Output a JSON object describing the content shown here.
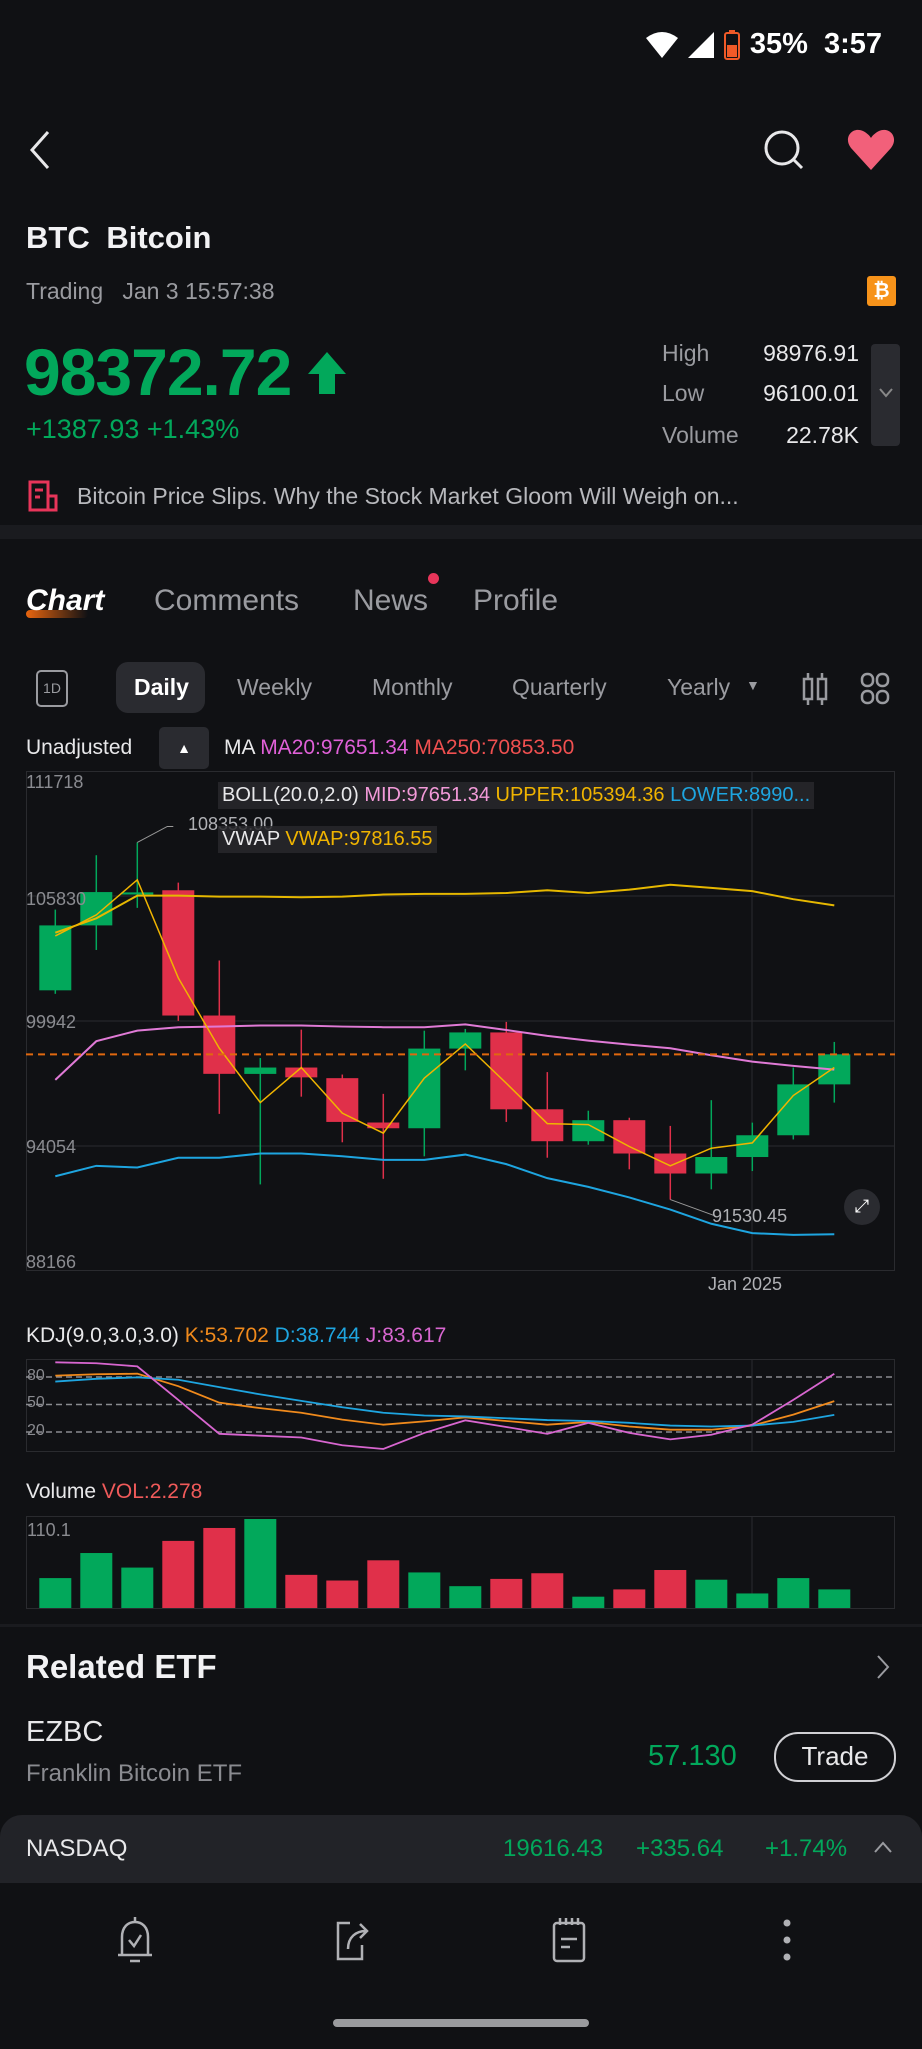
{
  "status_bar": {
    "battery": "35%",
    "time": "3:57"
  },
  "header": {
    "symbol": "BTC",
    "name": "Bitcoin",
    "state": "Trading",
    "timestamp": "Jan 3 15:57:38",
    "badge_icon": "bitcoin-icon"
  },
  "quote": {
    "price": "98372.72",
    "change": "+1387.93",
    "change_pct": "+1.43%",
    "direction": "up",
    "stats": [
      {
        "label": "High",
        "value": "98976.91"
      },
      {
        "label": "Low",
        "value": "96100.01"
      },
      {
        "label": "Volume",
        "value": "22.78K"
      }
    ]
  },
  "news_headline": "Bitcoin Price Slips. Why the Stock Market Gloom Will Weigh on...",
  "tabs": [
    {
      "label": "Chart",
      "active": true
    },
    {
      "label": "Comments"
    },
    {
      "label": "News",
      "dot": true
    },
    {
      "label": "Profile"
    }
  ],
  "periods": {
    "intraday_icon": "1D",
    "items": [
      "Daily",
      "Weekly",
      "Monthly",
      "Quarterly",
      "Yearly"
    ],
    "selected": "Daily"
  },
  "indicators": {
    "adjust": "Unadjusted",
    "ma_label": "MA",
    "ma20": "MA20:97651.34",
    "ma250": "MA250:70853.50",
    "boll_label": "BOLL(20.0,2.0)",
    "boll_mid": "MID:97651.34",
    "boll_upper": "UPPER:105394.36",
    "boll_lower": "LOWER:8990...",
    "vwap_label": "VWAP",
    "vwap_value": "VWAP:97816.55",
    "kdj_label": "KDJ(9.0,3.0,3.0)",
    "kdj_k": "K:53.702",
    "kdj_d": "D:38.744",
    "kdj_j": "J:83.617",
    "vol_label": "Volume",
    "vol_value": "VOL:2.278"
  },
  "colors": {
    "up": "#02a85b",
    "down": "#e0304a",
    "boll_upper": "#e6b800",
    "boll_mid": "#e07ad6",
    "boll_lower": "#1ea5e0",
    "vwap": "#f0b400",
    "k": "#f08a1c",
    "d": "#1ea5e0",
    "j": "#d866d0",
    "last_price": "#e0680f"
  },
  "chart_data": [
    {
      "type": "candlestick",
      "y_ticks": [
        "111718",
        "105830",
        "99942",
        "94054",
        "88166"
      ],
      "ylim": [
        88166,
        111718
      ],
      "x_label": "Jan 2025",
      "last_price": 98372.72,
      "annotations": {
        "high": "108353.00",
        "low": "91530.45"
      },
      "candles": [
        {
          "o": 101387,
          "h": 105189,
          "l": 101222,
          "c": 104445
        },
        {
          "o": 104445,
          "h": 107751,
          "l": 103288,
          "c": 106015
        },
        {
          "o": 105900,
          "h": 108353,
          "l": 105271,
          "c": 106000
        },
        {
          "o": 106100,
          "h": 106462,
          "l": 99949,
          "c": 100200
        },
        {
          "o": 100200,
          "h": 102792,
          "l": 95568,
          "c": 97453
        },
        {
          "o": 97450,
          "h": 98197,
          "l": 92245,
          "c": 97750
        },
        {
          "o": 97750,
          "h": 99535,
          "l": 96378,
          "c": 97287
        },
        {
          "o": 97250,
          "h": 97420,
          "l": 94229,
          "c": 95188
        },
        {
          "o": 95160,
          "h": 96510,
          "l": 92510,
          "c": 94890
        },
        {
          "o": 94890,
          "h": 99486,
          "l": 93568,
          "c": 98643
        },
        {
          "o": 98643,
          "h": 99568,
          "l": 97618,
          "c": 99404
        },
        {
          "o": 99404,
          "h": 99900,
          "l": 95188,
          "c": 95783
        },
        {
          "o": 95783,
          "h": 97535,
          "l": 93502,
          "c": 94279
        },
        {
          "o": 94279,
          "h": 95716,
          "l": 94114,
          "c": 95270
        },
        {
          "o": 95270,
          "h": 95386,
          "l": 92956,
          "c": 93700
        },
        {
          "o": 93700,
          "h": 95000,
          "l": 91530,
          "c": 92758
        },
        {
          "o": 92758,
          "h": 96213,
          "l": 92014,
          "c": 93535
        },
        {
          "o": 93535,
          "h": 95155,
          "l": 92874,
          "c": 94560
        },
        {
          "o": 94560,
          "h": 97750,
          "l": 94362,
          "c": 96957
        },
        {
          "o": 96957,
          "h": 98956,
          "l": 96098,
          "c": 98372
        }
      ],
      "series": [
        {
          "name": "UPPER",
          "values": [
            104100,
            104780,
            105850,
            105850,
            105800,
            105800,
            105770,
            105800,
            105900,
            105930,
            105930,
            105970,
            106100,
            105970,
            106130,
            106360,
            106210,
            106060,
            105680,
            105390
          ]
        },
        {
          "name": "MID",
          "values": [
            97170,
            98990,
            99490,
            99650,
            99680,
            99730,
            99730,
            99680,
            99650,
            99650,
            99780,
            99520,
            99240,
            99020,
            98830,
            98660,
            98330,
            98030,
            97830,
            97650
          ]
        },
        {
          "name": "LOWER",
          "values": [
            92630,
            93120,
            93040,
            93500,
            93500,
            93700,
            93700,
            93570,
            93400,
            93400,
            93650,
            93200,
            92540,
            92130,
            91630,
            91060,
            90390,
            89950,
            89870,
            89900
          ]
        },
        {
          "name": "VWAP",
          "values": [
            103950,
            104940,
            106590,
            101970,
            98660,
            96100,
            97750,
            95600,
            94660,
            97250,
            98860,
            97010,
            95110,
            95060,
            94030,
            93120,
            93950,
            94200,
            96430,
            97750
          ]
        }
      ]
    },
    {
      "type": "line",
      "y_ticks": [
        "80",
        "50",
        "20"
      ],
      "ylim": [
        -2,
        100
      ],
      "series": [
        {
          "name": "K",
          "values": [
            81.5,
            83,
            83.6,
            70,
            52,
            46,
            41,
            33.5,
            28,
            31.6,
            36,
            32,
            28,
            31,
            26,
            22.5,
            22.5,
            27,
            39,
            53.7
          ]
        },
        {
          "name": "D",
          "values": [
            75,
            78,
            79.6,
            77,
            69,
            61,
            54,
            47,
            41,
            38,
            37,
            35,
            33,
            32,
            30,
            27,
            26,
            27,
            31,
            38.7
          ]
        },
        {
          "name": "J",
          "values": [
            96,
            95,
            91.6,
            55,
            18,
            16,
            14,
            5.5,
            1.5,
            19,
            32.7,
            25.5,
            18,
            30,
            19,
            12,
            17,
            28,
            55,
            83.6
          ]
        }
      ]
    },
    {
      "type": "bar",
      "y_ticks": [
        "110.1"
      ],
      "ylim": [
        0,
        110.1
      ],
      "values": [
        37,
        68,
        50,
        83,
        99,
        110.1,
        41,
        34,
        59,
        44,
        27,
        36,
        43,
        14,
        23,
        47,
        35,
        18,
        37,
        23
      ]
    }
  ],
  "related_etf": {
    "title": "Related ETF",
    "items": [
      {
        "symbol": "EZBC",
        "name": "Franklin Bitcoin ETF",
        "price": "57.130",
        "action": "Trade"
      }
    ]
  },
  "index_ticker": {
    "name": "NASDAQ",
    "value": "19616.43",
    "change": "+335.64",
    "change_pct": "+1.74%"
  },
  "bottom_nav": [
    "alert-bell-icon",
    "share-icon",
    "notes-icon",
    "more-icon"
  ]
}
